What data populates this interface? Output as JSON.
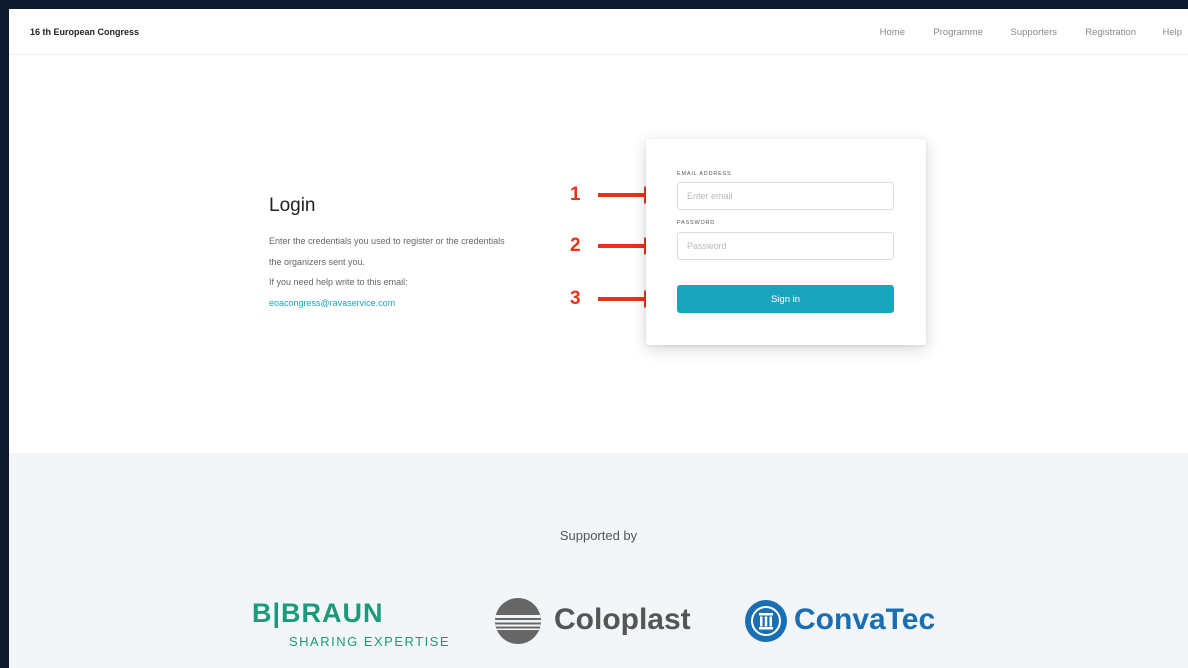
{
  "header": {
    "brand": "16 th European Congress",
    "nav": [
      {
        "label": "Home"
      },
      {
        "label": "Programme"
      },
      {
        "label": "Supporters"
      },
      {
        "label": "Registration"
      },
      {
        "label": "Help"
      }
    ]
  },
  "intro": {
    "title": "Login",
    "line1": "Enter the credentials you used to register or the credentials",
    "line2": "the organizers sent you.",
    "line3": "If you need help write to this email:",
    "email": "eoacongress@ravaservice.com"
  },
  "login_form": {
    "email_label": "EMAIL ADDRESS",
    "email_placeholder": "Enter email",
    "email_value": "",
    "password_label": "PASSWORD",
    "password_placeholder": "Password",
    "password_value": "",
    "signin_label": "Sign in",
    "accent_color": "#1aa5bf"
  },
  "annotations": [
    {
      "number": "1",
      "color": "#e8321a"
    },
    {
      "number": "2",
      "color": "#e8321a"
    },
    {
      "number": "3",
      "color": "#e8321a"
    }
  ],
  "footer": {
    "supported_by": "Supported by",
    "logos": {
      "braun_main": "B|BRAUN",
      "braun_sub": "SHARING EXPERTISE",
      "coloplast": "Coloplast",
      "convatec": "ConvaTec"
    }
  }
}
